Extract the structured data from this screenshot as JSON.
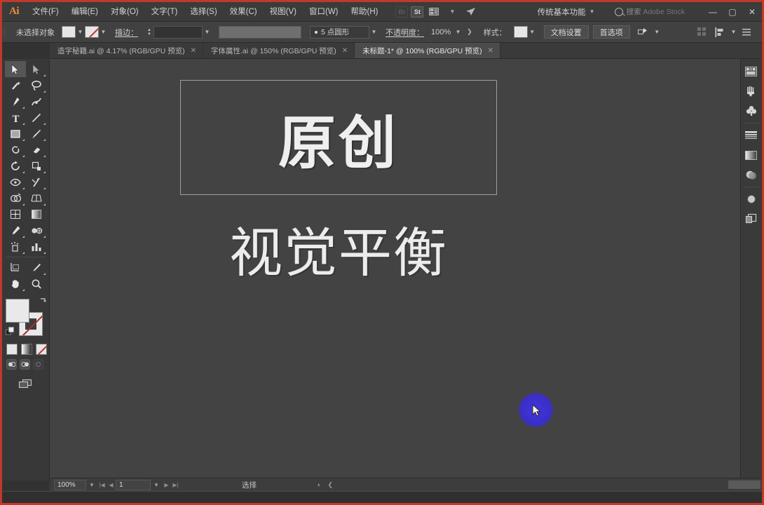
{
  "app": {
    "name": "Adobe Illustrator",
    "logo": "Ai",
    "workspace": "传统基本功能",
    "stock_search_label": "搜索",
    "stock_search_brand": "Adobe Stock"
  },
  "menubar": {
    "items": [
      {
        "label": "文件(F)",
        "name": "menu-file"
      },
      {
        "label": "编辑(E)",
        "name": "menu-edit"
      },
      {
        "label": "对象(O)",
        "name": "menu-object"
      },
      {
        "label": "文字(T)",
        "name": "menu-type"
      },
      {
        "label": "选择(S)",
        "name": "menu-select"
      },
      {
        "label": "效果(C)",
        "name": "menu-effect"
      },
      {
        "label": "视图(V)",
        "name": "menu-view"
      },
      {
        "label": "窗口(W)",
        "name": "menu-window"
      },
      {
        "label": "帮助(H)",
        "name": "menu-help"
      }
    ],
    "bridge_icon": "Br",
    "stock_icon": "St",
    "arrange_icon": "arrange-documents-icon",
    "share_icon": "share-icon",
    "window_controls": {
      "minimize": "—",
      "maximize": "▢",
      "close": "✕"
    }
  },
  "controlbar": {
    "selection_label": "未选择对象",
    "fill_swatch": "白色",
    "stroke_swatch": "无",
    "stroke_label": "描边：",
    "stroke_weight": "",
    "brush_label": "5 点圆形",
    "opacity_label": "不透明度：",
    "opacity_value": "100%",
    "style_label": "样式：",
    "doc_setup_button": "文档设置",
    "preferences_button": "首选项",
    "align_icon": "align-icon",
    "arrow_icon": "chevron-right-icon"
  },
  "tabs": [
    {
      "label": "造字秘籍.ai @ 4.17% (RGB/GPU 预览)",
      "active": false
    },
    {
      "label": "字体属性.ai @ 150% (RGB/GPU 预览)",
      "active": false
    },
    {
      "label": "未标题-1* @ 100% (RGB/GPU 预览)",
      "active": true
    }
  ],
  "toolbar": {
    "tools": [
      {
        "name": "selection-tool",
        "title": "选择工具",
        "selected": true
      },
      {
        "name": "direct-selection-tool",
        "title": "直接选择工具",
        "selected": false
      },
      {
        "name": "magic-wand-tool",
        "title": "魔棒工具",
        "selected": false
      },
      {
        "name": "lasso-tool",
        "title": "套索工具",
        "selected": false
      },
      {
        "name": "pen-tool",
        "title": "钢笔工具",
        "selected": false
      },
      {
        "name": "curvature-tool",
        "title": "曲率工具",
        "selected": false
      },
      {
        "name": "type-tool",
        "title": "文字工具",
        "selected": false
      },
      {
        "name": "line-segment-tool",
        "title": "直线段工具",
        "selected": false
      },
      {
        "name": "rectangle-tool",
        "title": "矩形工具",
        "selected": false
      },
      {
        "name": "paintbrush-tool",
        "title": "画笔工具",
        "selected": false
      },
      {
        "name": "shaper-tool",
        "title": "Shaper 工具",
        "selected": false
      },
      {
        "name": "eraser-tool",
        "title": "橡皮擦工具",
        "selected": false
      },
      {
        "name": "rotate-tool",
        "title": "旋转工具",
        "selected": false
      },
      {
        "name": "scale-tool",
        "title": "比例缩放工具",
        "selected": false
      },
      {
        "name": "width-tool",
        "title": "宽度工具",
        "selected": false
      },
      {
        "name": "free-transform-tool",
        "title": "自由变换工具",
        "selected": false
      },
      {
        "name": "shape-builder-tool",
        "title": "形状生成器工具",
        "selected": false
      },
      {
        "name": "perspective-grid-tool",
        "title": "透视网格工具",
        "selected": false
      },
      {
        "name": "mesh-tool",
        "title": "网格工具",
        "selected": false
      },
      {
        "name": "gradient-tool",
        "title": "渐变工具",
        "selected": false
      },
      {
        "name": "eyedropper-tool",
        "title": "吸管工具",
        "selected": false
      },
      {
        "name": "blend-tool",
        "title": "混合工具",
        "selected": false
      },
      {
        "name": "symbol-sprayer-tool",
        "title": "符号喷枪工具",
        "selected": false
      },
      {
        "name": "column-graph-tool",
        "title": "柱形图工具",
        "selected": false
      },
      {
        "name": "artboard-tool",
        "title": "画板工具",
        "selected": false
      },
      {
        "name": "slice-tool",
        "title": "切片工具",
        "selected": false
      },
      {
        "name": "hand-tool",
        "title": "抓手工具",
        "selected": false
      },
      {
        "name": "zoom-tool",
        "title": "缩放工具",
        "selected": false
      }
    ],
    "fill_stroke": {
      "fill_name": "fill-swatch",
      "stroke_name": "stroke-swatch",
      "swap_icon": "swap-fill-stroke-icon",
      "default_icon": "default-fill-stroke-icon"
    },
    "color_modes": [
      {
        "name": "color-swatch-button"
      },
      {
        "name": "gradient-swatch-button"
      },
      {
        "name": "none-swatch-button"
      }
    ],
    "screen_modes": [
      {
        "name": "draw-normal-button"
      },
      {
        "name": "draw-behind-button"
      },
      {
        "name": "draw-inside-button"
      }
    ],
    "screen_mode_button": "change-screen-mode-button"
  },
  "canvas": {
    "artwork_title": "原创",
    "artwork_subtitle": "视觉平衡",
    "cursor": "arrow-cursor",
    "highlight_color": "#3a2ecc"
  },
  "rightdock": {
    "panels": [
      {
        "name": "panel-color-icon",
        "title": "颜色"
      },
      {
        "name": "panel-brushes-icon",
        "title": "画笔"
      },
      {
        "name": "panel-symbols-icon",
        "title": "符号"
      },
      {
        "name": "panel-stroke-icon",
        "title": "描边"
      },
      {
        "name": "panel-gradient-icon",
        "title": "渐变"
      },
      {
        "name": "panel-transparency-icon",
        "title": "透明度"
      },
      {
        "name": "panel-appearance-icon",
        "title": "外观"
      },
      {
        "name": "panel-layers-icon",
        "title": "图层"
      }
    ]
  },
  "statusbar": {
    "zoom": "100%",
    "page": "1",
    "status_text": "选择",
    "first_icon": "first-page-icon",
    "prev_icon": "prev-page-icon",
    "next_icon": "next-page-icon",
    "last_icon": "last-page-icon"
  }
}
